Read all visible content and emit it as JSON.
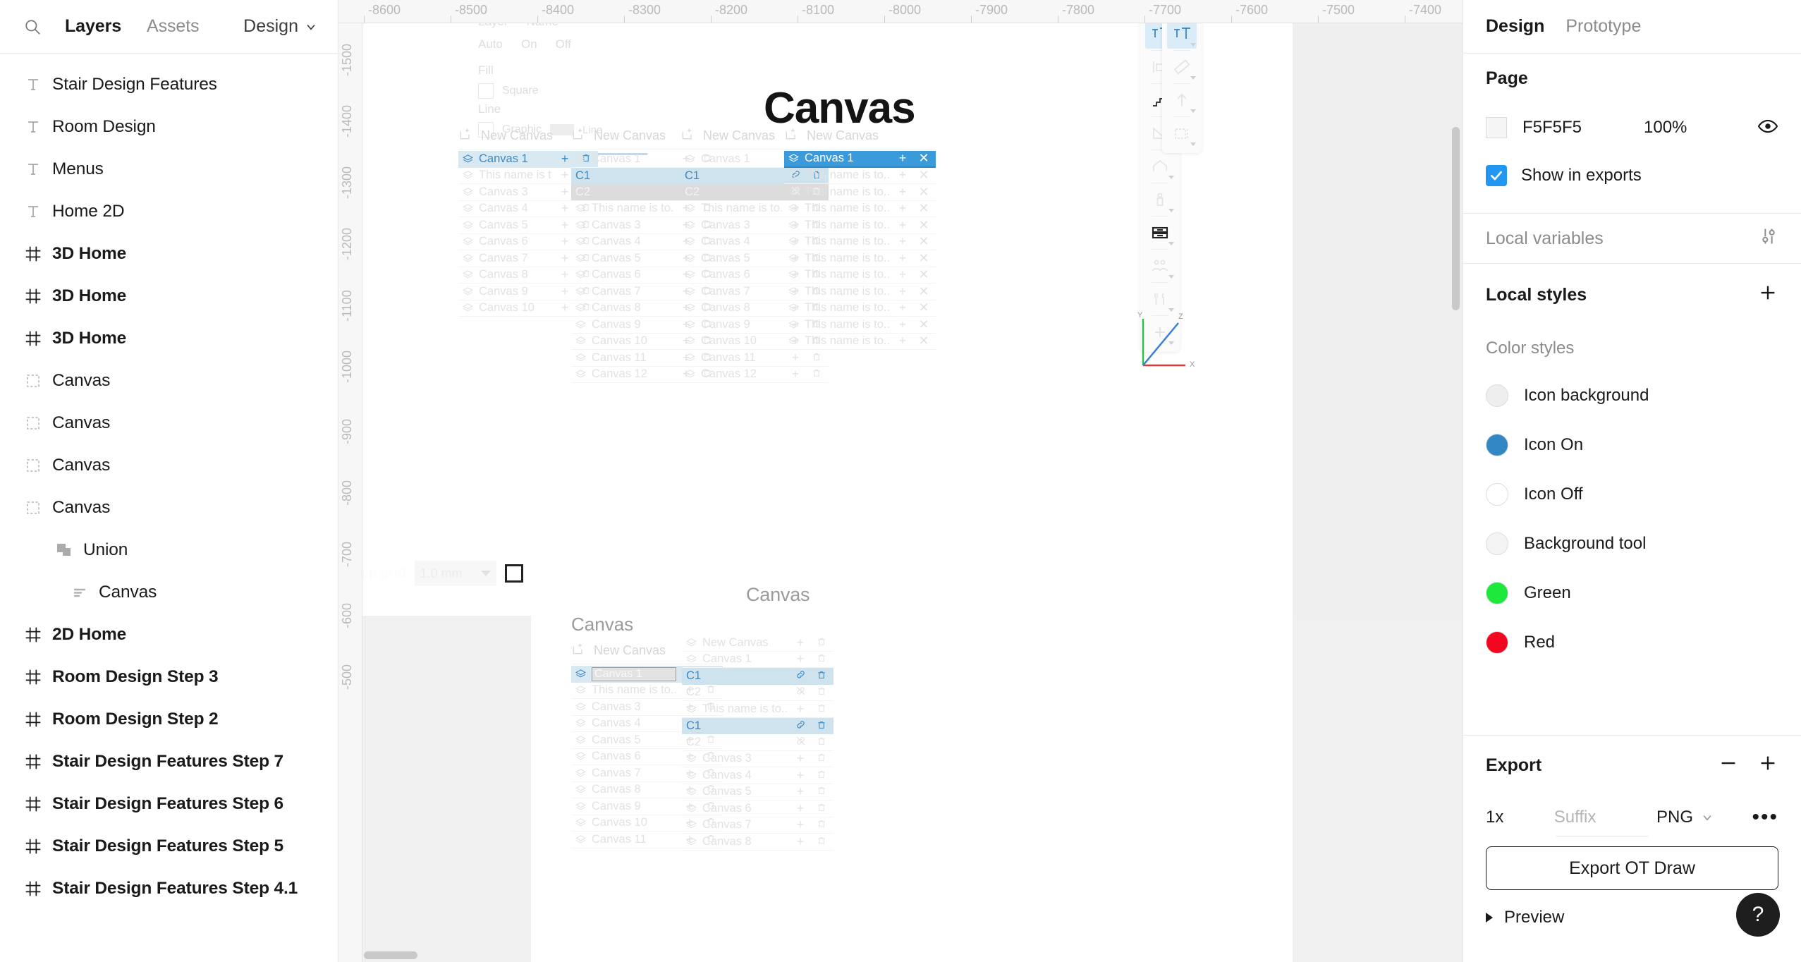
{
  "left_panel": {
    "search_icon": "search-icon",
    "tabs": [
      {
        "label": "Layers",
        "active": true
      },
      {
        "label": "Assets",
        "active": false
      }
    ],
    "design_menu": {
      "label": "Design",
      "caret": "chevron-down-icon"
    },
    "layers": [
      {
        "label": "Stair Design Features",
        "icon": "text-icon",
        "bold": false,
        "indent": 0
      },
      {
        "label": "Room Design",
        "icon": "text-icon",
        "bold": false,
        "indent": 0
      },
      {
        "label": "Menus",
        "icon": "text-icon",
        "bold": false,
        "indent": 0
      },
      {
        "label": "Home 2D",
        "icon": "text-icon",
        "bold": false,
        "indent": 0
      },
      {
        "label": "3D Home",
        "icon": "frame-icon",
        "bold": true,
        "indent": 0
      },
      {
        "label": "3D Home",
        "icon": "frame-icon",
        "bold": true,
        "indent": 0
      },
      {
        "label": "3D Home",
        "icon": "frame-icon",
        "bold": true,
        "indent": 0
      },
      {
        "label": "Canvas",
        "icon": "group-icon",
        "bold": false,
        "indent": 0
      },
      {
        "label": "Canvas",
        "icon": "group-icon",
        "bold": false,
        "indent": 0
      },
      {
        "label": "Canvas",
        "icon": "group-icon",
        "bold": false,
        "indent": 0
      },
      {
        "label": "Canvas",
        "icon": "group-icon",
        "bold": false,
        "indent": 0
      },
      {
        "label": "Union",
        "icon": "union-icon",
        "bold": false,
        "indent": 1
      },
      {
        "label": "Canvas",
        "icon": "list-icon",
        "bold": false,
        "indent": 2
      },
      {
        "label": "2D Home",
        "icon": "frame-icon",
        "bold": true,
        "indent": 0
      },
      {
        "label": "Room Design Step 3",
        "icon": "frame-icon",
        "bold": true,
        "indent": 0
      },
      {
        "label": "Room Design Step 2",
        "icon": "frame-icon",
        "bold": true,
        "indent": 0
      },
      {
        "label": "Stair Design Features Step 7",
        "icon": "frame-icon",
        "bold": true,
        "indent": 0
      },
      {
        "label": "Stair Design Features Step 6",
        "icon": "frame-icon",
        "bold": true,
        "indent": 0
      },
      {
        "label": "Stair Design Features Step 5",
        "icon": "frame-icon",
        "bold": true,
        "indent": 0
      },
      {
        "label": "Stair Design Features Step 4.1",
        "icon": "frame-icon",
        "bold": true,
        "indent": 0
      }
    ]
  },
  "canvas": {
    "ruler_h_ticks": [
      "-8600",
      "-8500",
      "-8400",
      "-8300",
      "-8200",
      "-8100",
      "-8000",
      "-7900",
      "-7800",
      "-7700",
      "-7600",
      "-7500",
      "-7400"
    ],
    "ruler_v_ticks": [
      "-1500",
      "-1400",
      "-1300",
      "-1200",
      "-1100",
      "-1000",
      "-900",
      "-800",
      "-700",
      "-600",
      "-500"
    ],
    "big_title": "Canvas",
    "small_title": "Canvas",
    "snap": {
      "label": "Snap grid",
      "value": "1.0 mm",
      "caret": "caret-down-icon"
    },
    "new_canvas_label": "New Canvas",
    "truncated_name": "This name is to...",
    "widget_a": {
      "rows": [
        "Canvas 1",
        "This name is to...",
        "Canvas 3",
        "Canvas 4",
        "Canvas 5",
        "Canvas 6",
        "Canvas 7",
        "Canvas 8",
        "Canvas 9",
        "Canvas 10"
      ],
      "selected_index": 0
    },
    "widget_b": {
      "rows": [
        "Canvas 1",
        "C1",
        "C2",
        "This name is to...",
        "Canvas 3",
        "Canvas 4",
        "Canvas 5",
        "Canvas 6",
        "Canvas 7",
        "Canvas 8",
        "Canvas 9",
        "Canvas 10",
        "Canvas 11",
        "Canvas 12"
      ],
      "selected_index": 1,
      "disabled_index": 2
    },
    "widget_c": {
      "rows": [
        "Canvas 1",
        "This name is to...",
        "This name is to...",
        "This name is to...",
        "This name is to...",
        "This name is to...",
        "This name is to...",
        "This name is to...",
        "This name is to...",
        "This name is to...",
        "This name is to...",
        "This name is to..."
      ],
      "selected_index": 0
    },
    "widget_d": {
      "title": "Canvas",
      "edit_value": "Canvas 1",
      "rows": [
        "Canvas 1",
        "This name is to...",
        "Canvas 3",
        "Canvas 4",
        "Canvas 5",
        "Canvas 6",
        "Canvas 7",
        "Canvas 8",
        "Canvas 9",
        "Canvas 10",
        "Canvas 11"
      ],
      "selected_index": 0
    },
    "widget_e": {
      "rows": [
        "New Canvas",
        "Canvas 1",
        "C1",
        "C2",
        "This name is to...",
        "C1",
        "C2",
        "Canvas 3",
        "Canvas 4",
        "Canvas 5",
        "Canvas 6",
        "Canvas 7",
        "Canvas 8"
      ],
      "selected_indices": [
        2,
        5
      ]
    },
    "left_form": {
      "fill_label": "Fill",
      "line_label": "Line",
      "rows": [
        "Auto",
        "Square",
        "Graphic"
      ]
    },
    "tools_main": [
      {
        "name": "text-tool-icon",
        "active": true
      },
      {
        "name": "wall-tool-icon",
        "active": false
      },
      {
        "name": "stairs-tool-icon",
        "active": false
      },
      {
        "name": "roof-tool-icon",
        "active": false
      },
      {
        "name": "house-tool-icon",
        "active": false
      },
      {
        "name": "person-tool-icon",
        "active": false
      },
      {
        "name": "furniture-tool-icon",
        "active": false
      },
      {
        "name": "people-tool-icon",
        "active": false
      },
      {
        "name": "dining-tool-icon",
        "active": false
      },
      {
        "name": "add-tool-icon",
        "active": false
      }
    ],
    "tools_secondary": [
      {
        "name": "text-tool-icon",
        "active": true
      },
      {
        "name": "ruler-tool-icon",
        "active": false
      },
      {
        "name": "arrow-up-tool-icon",
        "active": false
      },
      {
        "name": "measure-tool-icon",
        "active": false
      }
    ],
    "axis_labels": {
      "y": "Y",
      "z": "Z",
      "x": "X"
    }
  },
  "right_panel": {
    "tabs": [
      {
        "label": "Design",
        "active": true
      },
      {
        "label": "Prototype",
        "active": false
      }
    ],
    "page": {
      "title": "Page",
      "color_hex": "F5F5F5",
      "color_value": "#F5F5F5",
      "opacity": "100%",
      "eye_icon": "eye-icon",
      "show_in_exports": "Show in exports",
      "show_in_exports_checked": true,
      "accent": "#2196f3"
    },
    "local_variables": {
      "title": "Local variables",
      "icon": "sliders-icon"
    },
    "local_styles": {
      "title": "Local styles",
      "add_icon": "plus-icon"
    },
    "color_styles": {
      "title": "Color styles",
      "items": [
        {
          "name": "Icon background",
          "color": "#eeeeee"
        },
        {
          "name": "Icon On",
          "color": "#3288c4"
        },
        {
          "name": "Icon Off",
          "color": "#ffffff"
        },
        {
          "name": "Background tool",
          "color": "#f4f4f4"
        },
        {
          "name": "Green",
          "color": "#1fe83c"
        },
        {
          "name": "Red",
          "color": "#f3061f"
        }
      ]
    },
    "export": {
      "title": "Export",
      "minus_icon": "minus-icon",
      "plus_icon": "plus-icon",
      "scale": "1x",
      "suffix_placeholder": "Suffix",
      "format": "PNG",
      "format_caret": "chevron-down-icon",
      "more_icon": "ellipsis-icon",
      "button_label": "Export OT Draw",
      "preview_label": "Preview"
    },
    "help_label": "?"
  }
}
